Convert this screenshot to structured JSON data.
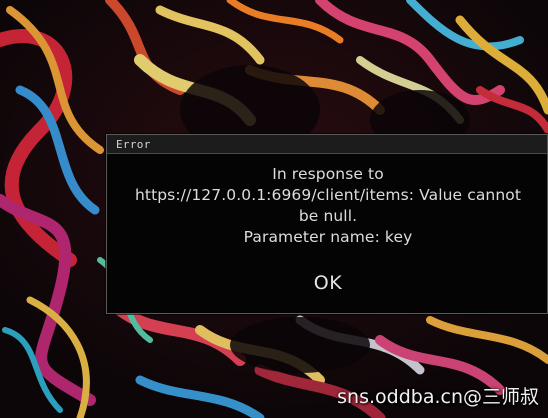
{
  "dialog": {
    "title": "Error",
    "message_lines": [
      "In response to",
      "https://127.0.0.1:6969/client/items: Value cannot",
      "be null.",
      "Parameter name: key"
    ],
    "ok_label": "OK"
  },
  "watermark": "sns.oddba.cn@三师叔",
  "colors": {
    "dialog_bg": "#040404",
    "titlebar_bg": "#1c1c1c",
    "text": "#dcdcdc"
  }
}
